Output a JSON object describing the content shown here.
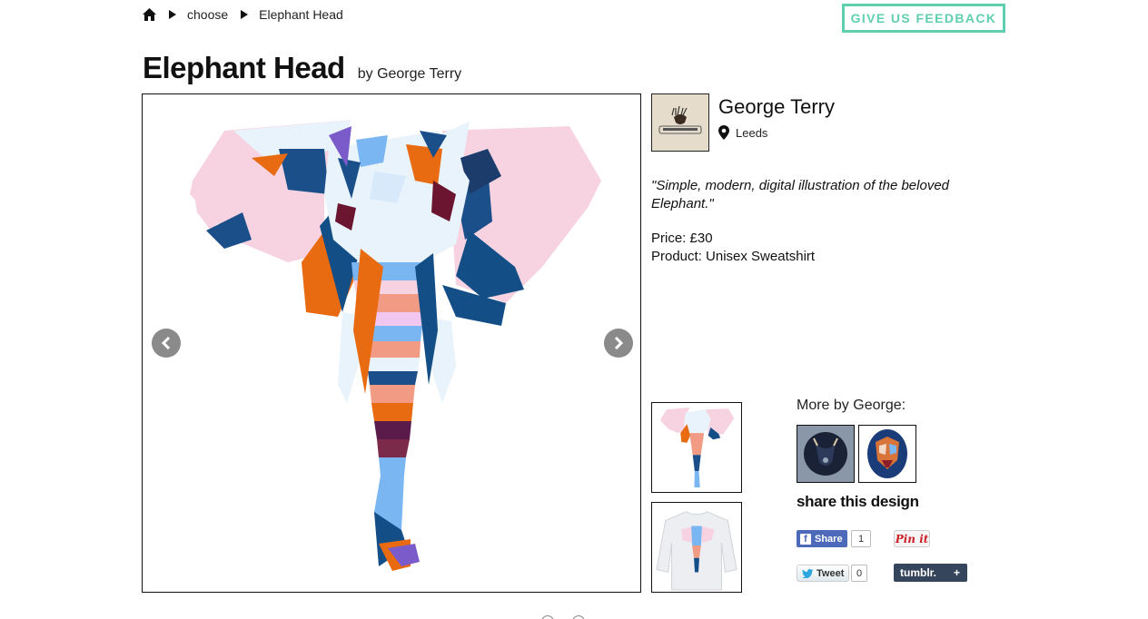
{
  "breadcrumb": {
    "home_icon": "home-icon",
    "items": [
      "choose",
      "Elephant Head"
    ]
  },
  "feedback": {
    "label": "GIVE US FEEDBACK",
    "color": "#5fcfb0"
  },
  "design": {
    "title": "Elephant Head",
    "byline": "by George Terry",
    "quote": "\"Simple, modern, digital illustration of the beloved Elephant.\"",
    "price": "Price: £30",
    "product": "Product: Unisex Sweatshirt"
  },
  "artist": {
    "name": "George Terry",
    "location": "Leeds",
    "location_icon": "map-pin-icon"
  },
  "viewer": {
    "prev_icon": "chevron-left-icon",
    "next_icon": "chevron-right-icon"
  },
  "more": {
    "label": "More by George:"
  },
  "share": {
    "label": "share this design",
    "facebook": {
      "label": "Share",
      "count": "1",
      "color": "#4c69ba"
    },
    "pinterest": {
      "label": "Pin it",
      "color": "#cb2027"
    },
    "twitter": {
      "label": "Tweet",
      "count": "0"
    },
    "tumblr": {
      "label": "tumblr.",
      "plus": "+",
      "color": "#35465c"
    }
  }
}
